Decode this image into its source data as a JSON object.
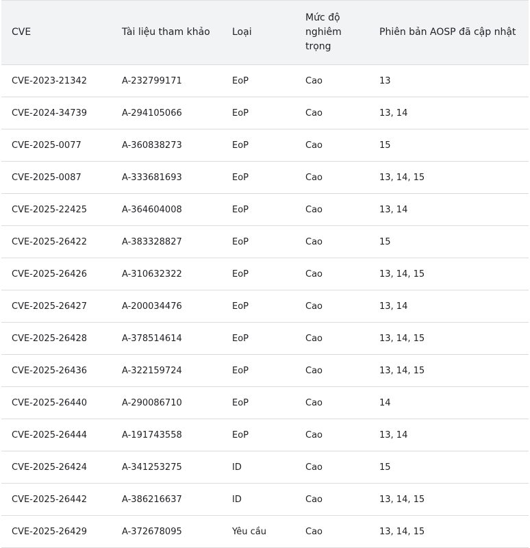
{
  "table": {
    "headers": {
      "cve": "CVE",
      "reference": "Tài liệu tham khảo",
      "type": "Loại",
      "severity": "Mức độ nghiêm trọng",
      "aosp_versions": "Phiên bản AOSP đã cập nhật"
    },
    "rows": [
      {
        "cve": "CVE-2023-21342",
        "reference": "A-232799171",
        "type": "EoP",
        "severity": "Cao",
        "versions": "13"
      },
      {
        "cve": "CVE-2024-34739",
        "reference": "A-294105066",
        "type": "EoP",
        "severity": "Cao",
        "versions": "13, 14"
      },
      {
        "cve": "CVE-2025-0077",
        "reference": "A-360838273",
        "type": "EoP",
        "severity": "Cao",
        "versions": "15"
      },
      {
        "cve": "CVE-2025-0087",
        "reference": "A-333681693",
        "type": "EoP",
        "severity": "Cao",
        "versions": "13, 14, 15"
      },
      {
        "cve": "CVE-2025-22425",
        "reference": "A-364604008",
        "type": "EoP",
        "severity": "Cao",
        "versions": "13, 14"
      },
      {
        "cve": "CVE-2025-26422",
        "reference": "A-383328827",
        "type": "EoP",
        "severity": "Cao",
        "versions": "15"
      },
      {
        "cve": "CVE-2025-26426",
        "reference": "A-310632322",
        "type": "EoP",
        "severity": "Cao",
        "versions": "13, 14, 15"
      },
      {
        "cve": "CVE-2025-26427",
        "reference": "A-200034476",
        "type": "EoP",
        "severity": "Cao",
        "versions": "13, 14"
      },
      {
        "cve": "CVE-2025-26428",
        "reference": "A-378514614",
        "type": "EoP",
        "severity": "Cao",
        "versions": "13, 14, 15"
      },
      {
        "cve": "CVE-2025-26436",
        "reference": "A-322159724",
        "type": "EoP",
        "severity": "Cao",
        "versions": "13, 14, 15"
      },
      {
        "cve": "CVE-2025-26440",
        "reference": "A-290086710",
        "type": "EoP",
        "severity": "Cao",
        "versions": "14"
      },
      {
        "cve": "CVE-2025-26444",
        "reference": "A-191743558",
        "type": "EoP",
        "severity": "Cao",
        "versions": "13, 14"
      },
      {
        "cve": "CVE-2025-26424",
        "reference": "A-341253275",
        "type": "ID",
        "severity": "Cao",
        "versions": "15"
      },
      {
        "cve": "CVE-2025-26442",
        "reference": "A-386216637",
        "type": "ID",
        "severity": "Cao",
        "versions": "13, 14, 15"
      },
      {
        "cve": "CVE-2025-26429",
        "reference": "A-372678095",
        "type": "Yêu cầu",
        "severity": "Cao",
        "versions": "13, 14, 15"
      }
    ]
  }
}
